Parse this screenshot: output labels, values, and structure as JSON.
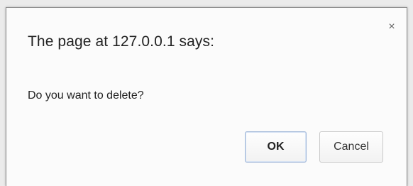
{
  "dialog": {
    "title": "The page at 127.0.0.1 says:",
    "message": "Do you want to delete?",
    "close_glyph": "×",
    "ok_label": "OK",
    "cancel_label": "Cancel"
  },
  "colors": {
    "background": "#ebebeb",
    "dialog_bg": "#fbfbfb",
    "ok_border": "#9fb6d8"
  }
}
